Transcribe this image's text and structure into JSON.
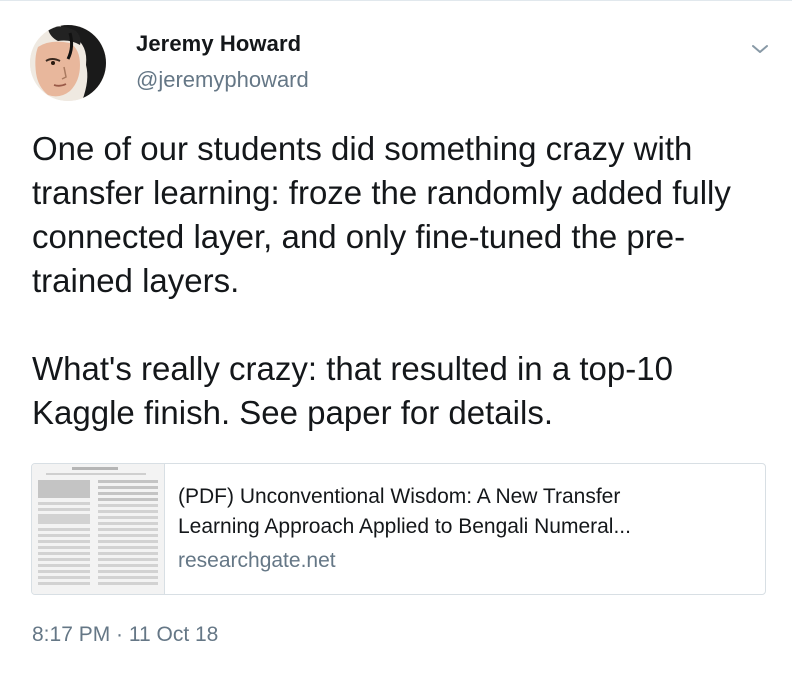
{
  "author": {
    "display_name": "Jeremy Howard",
    "handle": "@jeremyphoward"
  },
  "tweet": {
    "paragraphs": [
      "One of our students did something crazy with transfer learning: froze the randomly added fully connected layer, and only fine-tuned the pre-trained layers.",
      "What's really crazy: that resulted in a top-10 Kaggle finish. See paper for details."
    ],
    "timestamp": "8:17 PM · 11 Oct 18"
  },
  "link_card": {
    "title_line_1": "(PDF) Unconventional Wisdom: A New Transfer",
    "title_line_2": "Learning Approach Applied to Bengali Numeral...",
    "domain": "researchgate.net"
  },
  "icons": {
    "menu": "chevron-down-icon"
  },
  "colors": {
    "text": "#14171a",
    "secondary_text": "#657786",
    "border": "#d8dfe4"
  }
}
